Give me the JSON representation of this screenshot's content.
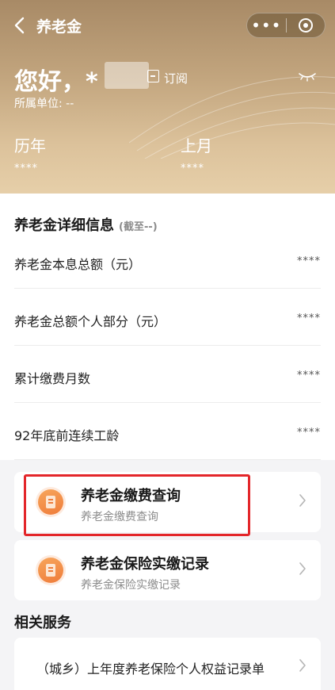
{
  "navbar": {
    "title": "养老金",
    "more_icon": "ellipsis-icon",
    "close_icon": "target-circle-icon"
  },
  "header": {
    "greeting": "您好，*",
    "subscribe_label": "订阅",
    "unit_label": "所属单位: --",
    "stats": [
      {
        "label": "历年",
        "value": "****"
      },
      {
        "label": "上月",
        "value": "****"
      }
    ]
  },
  "detail": {
    "title": "养老金详细信息",
    "note": "(截至--)",
    "rows": [
      {
        "label": "养老金本息总额（元）",
        "value": "****"
      },
      {
        "label": "养老金总额个人部分（元）",
        "value": "****"
      },
      {
        "label": "累计缴费月数",
        "value": "****"
      },
      {
        "label": "92年底前连续工龄",
        "value": "****"
      }
    ]
  },
  "cards": [
    {
      "title": "养老金缴费查询",
      "subtitle": "养老金缴费查询"
    },
    {
      "title": "养老金保险实缴记录",
      "subtitle": "养老金保险实缴记录"
    }
  ],
  "related": {
    "title": "相关服务",
    "items": [
      {
        "label": "（城乡）上年度养老保险个人权益记录单"
      }
    ]
  },
  "colors": {
    "header_gold": "#c2a57e",
    "highlight_red": "#e3262a",
    "icon_orange": "#ef7c3a"
  }
}
